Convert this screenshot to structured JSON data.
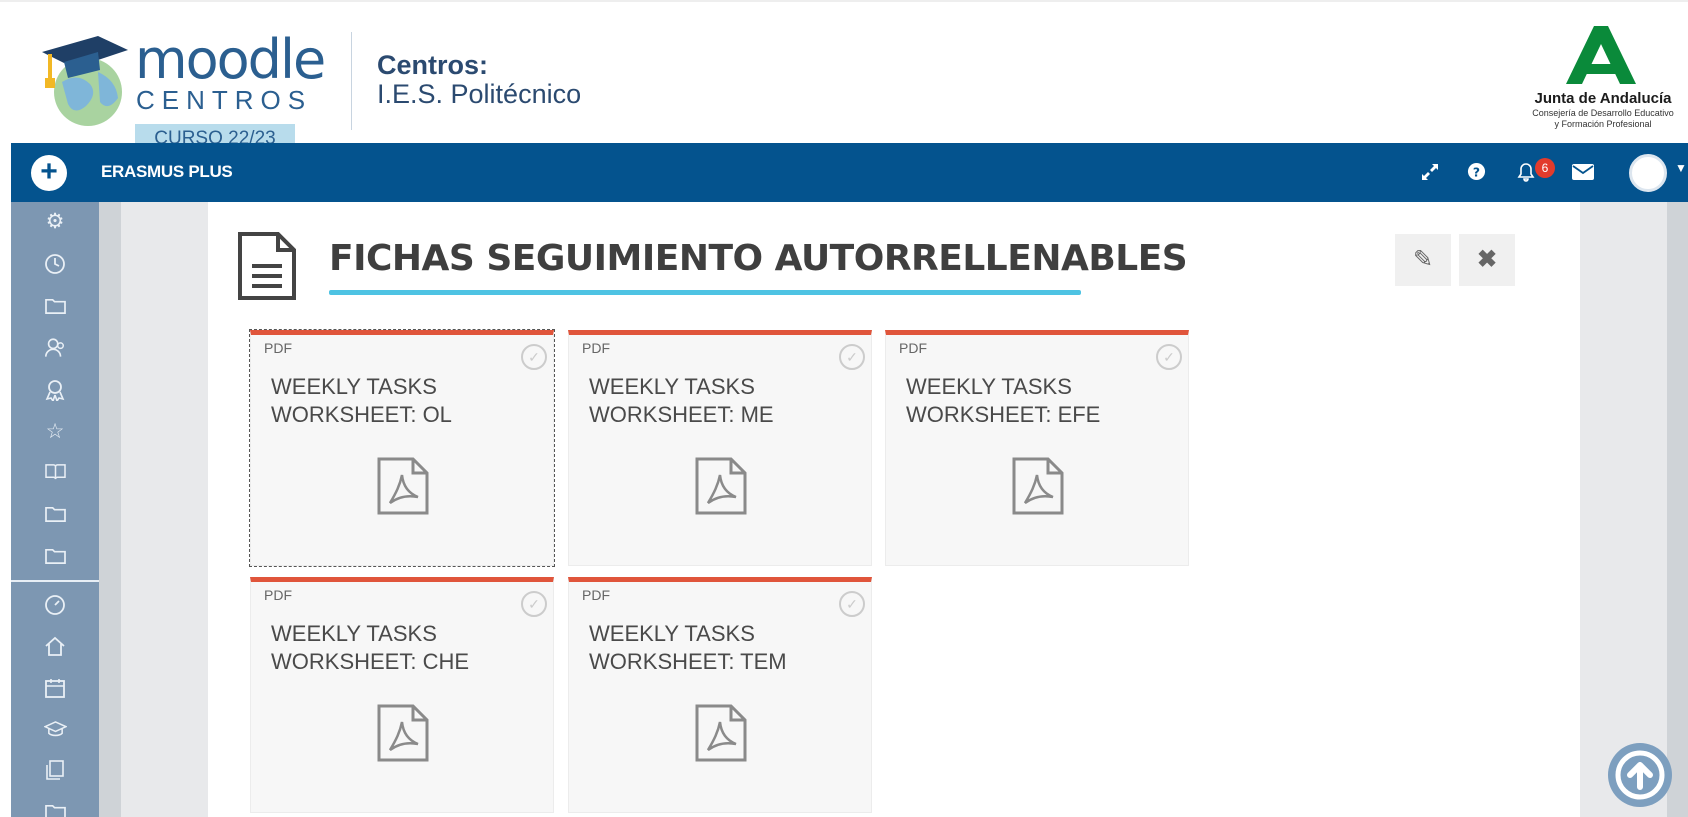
{
  "brand": {
    "moodle_word": "moodle",
    "centros_word": "CENTROS",
    "curso": "CURSO 22/23",
    "centro_label": "Centros:",
    "centro_name": "I.E.S. Politécnico",
    "junta_title": "Junta de Andalucía",
    "junta_sub1": "Consejería de Desarrollo Educativo",
    "junta_sub2": "y Formación Profesional"
  },
  "navbar": {
    "add_symbol": "+",
    "course_name": "ERASMUS PLUS",
    "notification_count": "6",
    "icons": [
      "expand-icon",
      "help-icon",
      "bell-icon",
      "envelope-icon",
      "avatar"
    ]
  },
  "sidebar": {
    "icons": [
      "gears-icon",
      "clock-icon",
      "folder-icon",
      "users-icon",
      "badge-icon",
      "star-icon",
      "book-icon",
      "folder-icon",
      "folder-icon",
      "dashboard-icon",
      "home-icon",
      "calendar-icon",
      "graduation-cap-icon",
      "files-icon",
      "folder-icon"
    ]
  },
  "section": {
    "title": "FICHAS SEGUIMIENTO AUTORRELLENABLES",
    "edit_symbol": "✎",
    "close_symbol": "✖"
  },
  "tiles": [
    {
      "type": "PDF",
      "title": "WEEKLY TASKS WORKSHEET: OL"
    },
    {
      "type": "PDF",
      "title": "WEEKLY TASKS WORKSHEET: ME"
    },
    {
      "type": "PDF",
      "title": "WEEKLY TASKS WORKSHEET: EFE"
    },
    {
      "type": "PDF",
      "title": "WEEKLY TASKS WORKSHEET: CHE"
    },
    {
      "type": "PDF",
      "title": "WEEKLY TASKS WORKSHEET: TEM"
    }
  ],
  "colors": {
    "navbar": "#04538e",
    "sidebar": "#7d97b2",
    "tile_accent": "#e0553b",
    "title_underline": "#4ec3e3",
    "notification_badge": "#e23b2c"
  }
}
